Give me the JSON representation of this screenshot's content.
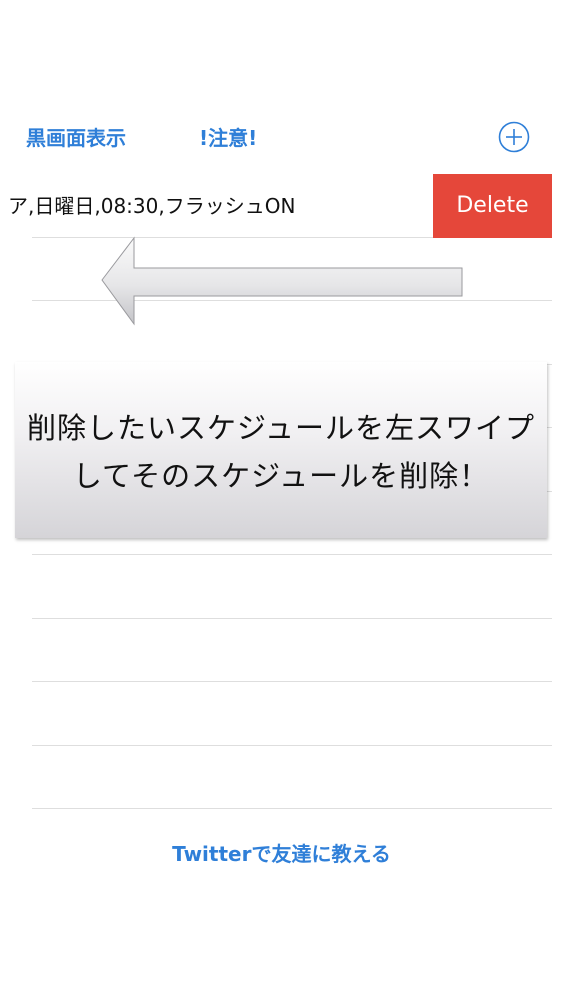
{
  "nav": {
    "black_screen_label": "黒画面表示",
    "caution_label": "!注意!",
    "add_icon": "plus-circle-icon"
  },
  "schedule": {
    "rows": [
      {
        "text": "ア,日曜日,08:30,フラッシュON"
      }
    ],
    "delete_label": "Delete"
  },
  "hint": {
    "line1": "削除したいスケジュールを左スワイプ",
    "line2": "してそのスケジュールを削除！",
    "arrow_icon": "left-arrow-icon"
  },
  "footer": {
    "twitter_label": "Twitterで友達に教える"
  },
  "colors": {
    "accent": "#2f7fd8",
    "delete": "#e5473a",
    "separator": "#dedede"
  }
}
